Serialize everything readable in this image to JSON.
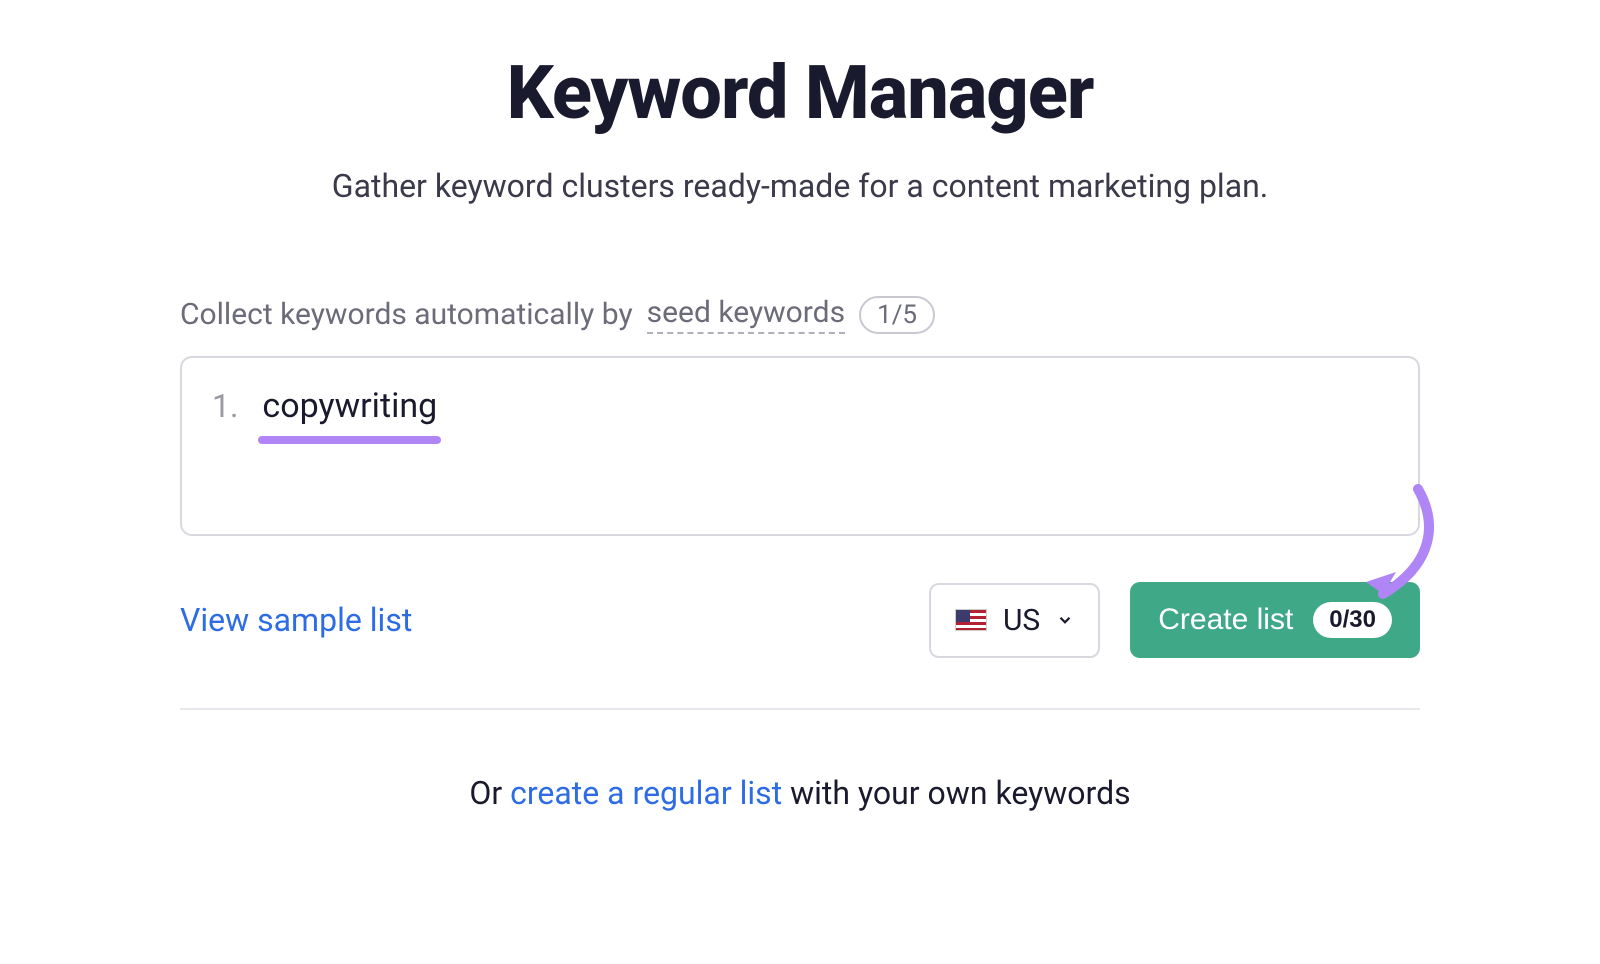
{
  "header": {
    "title": "Keyword Manager",
    "subtitle": "Gather keyword clusters ready-made for a content marketing plan."
  },
  "collect": {
    "prefix": "Collect keywords automatically by ",
    "seed_label": "seed keywords",
    "count_badge": "1/5"
  },
  "keywords": {
    "row1_number": "1.",
    "row1_value": "copywriting"
  },
  "actions": {
    "view_sample_label": "View sample list",
    "country_code": "US",
    "create_label": "Create list",
    "create_count": "0/30"
  },
  "footer": {
    "prefix": "Or ",
    "link_label": "create a regular list",
    "suffix": " with your own keywords"
  }
}
